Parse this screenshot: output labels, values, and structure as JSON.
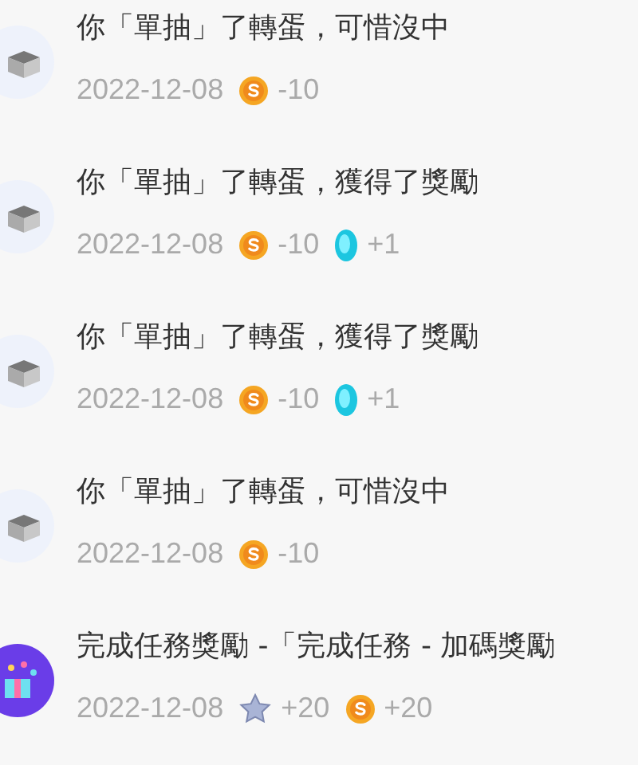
{
  "records": [
    {
      "kind": "box",
      "title": "你「單抽」了轉蛋，可惜沒中",
      "date": "2022-12-08",
      "rewards": [
        {
          "kind": "coin",
          "amount": "-10"
        }
      ]
    },
    {
      "kind": "box",
      "title": "你「單抽」了轉蛋，獲得了獎勵",
      "date": "2022-12-08",
      "rewards": [
        {
          "kind": "coin",
          "amount": "-10"
        },
        {
          "kind": "gem",
          "amount": "+1"
        }
      ]
    },
    {
      "kind": "box",
      "title": "你「單抽」了轉蛋，獲得了獎勵",
      "date": "2022-12-08",
      "rewards": [
        {
          "kind": "coin",
          "amount": "-10"
        },
        {
          "kind": "gem",
          "amount": "+1"
        }
      ]
    },
    {
      "kind": "box",
      "title": "你「單抽」了轉蛋，可惜沒中",
      "date": "2022-12-08",
      "rewards": [
        {
          "kind": "coin",
          "amount": "-10"
        }
      ]
    },
    {
      "kind": "gift",
      "title": "完成任務獎勵 -「完成任務 - 加碼獎勵",
      "date": "2022-12-08",
      "rewards": [
        {
          "kind": "star",
          "amount": "+20"
        },
        {
          "kind": "coin",
          "amount": "+20"
        }
      ]
    }
  ]
}
